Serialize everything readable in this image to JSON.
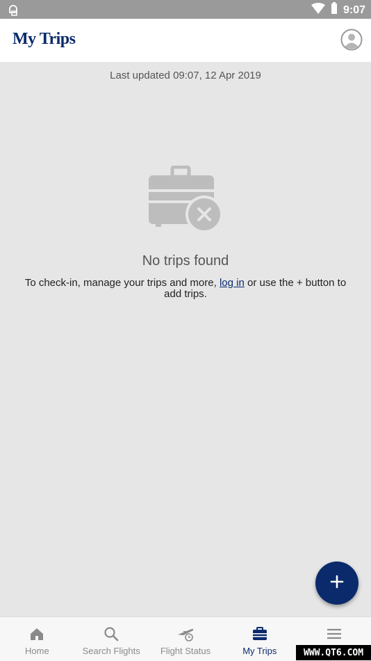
{
  "status_bar": {
    "time": "9:07",
    "left_icon": "notification-icon",
    "icons": [
      "wifi-icon",
      "battery-icon"
    ]
  },
  "app_bar": {
    "title": "My Trips",
    "profile_icon": "profile-icon"
  },
  "main": {
    "last_updated": "Last updated 09:07, 12 Apr 2019",
    "empty_state": {
      "icon": "suitcase-cross-icon",
      "title": "No trips found",
      "message_before": "To check-in, manage your trips and more, ",
      "login_link": "log in",
      "message_after": " or use the + button to add trips."
    }
  },
  "fab": {
    "icon": "plus-icon",
    "color": "#0a2a6b"
  },
  "bottom_nav": {
    "items": [
      {
        "label": "Home",
        "icon": "home-icon"
      },
      {
        "label": "Search Flights",
        "icon": "search-icon"
      },
      {
        "label": "Flight Status",
        "icon": "flight-status-icon"
      },
      {
        "label": "My Trips",
        "icon": "suitcase-icon",
        "active": true
      },
      {
        "label": "",
        "icon": "menu-icon"
      }
    ],
    "active_color": "#0a2a6b",
    "inactive_color": "#8a8a8a"
  },
  "watermark": "WWW.QT6.COM"
}
